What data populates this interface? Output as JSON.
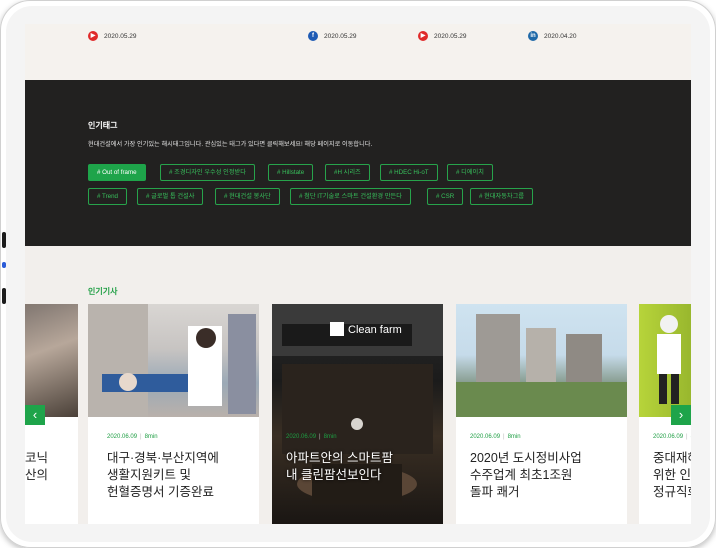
{
  "social_feed": [
    {
      "icon": "youtube-icon",
      "date": "2020.05.29"
    },
    {
      "icon": "facebook-icon",
      "date": "2020.05.29"
    },
    {
      "icon": "youtube-icon",
      "date": "2020.05.29"
    },
    {
      "icon": "linkedin-icon",
      "date": "2020.04.20"
    }
  ],
  "popular_tags": {
    "title": "인기태그",
    "description": "현대건설에서 가장 인기있는 해시태그입니다. 관심있는 태그가 있다면 클릭해보세요! 해당 페이지로 이동합니다.",
    "tags": [
      "# Out of frame",
      "# 조경디자인 우수성 인정받다",
      "# Hillstate",
      "#H 시리즈",
      "# HDEC Hi-oT",
      "# 디에이치",
      "# Trend",
      "# 글로벌 톱 건설사",
      "# 현대건설 봉사단",
      "# 첨단 IT기술로 스마트 건설환경 만든다",
      "# CSR",
      "# 현대자동차그룹"
    ],
    "active_index": 0
  },
  "popular_articles": {
    "title": "인기기사",
    "cards": [
      {
        "date": "",
        "read_time": "",
        "title": "코닉\n산의"
      },
      {
        "date": "2020.06.09",
        "read_time": "8min",
        "title": "대구·경북·부산지역에\n생활지원키트 및\n헌혈증명서 기증완료"
      },
      {
        "date": "2020.06.09",
        "read_time": "8min",
        "title": "아파트안의 스마트팜\n내 클린팜선보인다",
        "sign": "Clean farm"
      },
      {
        "date": "2020.06.09",
        "read_time": "8min",
        "title": "2020년 도시정비사업\n수주업계 최초1조원\n돌파 쾌거"
      },
      {
        "date": "2020.06.09",
        "read_time": "8",
        "title": "중대재해\n위한 인\n정규직화"
      }
    ],
    "prev_label": "‹",
    "next_label": "›"
  },
  "colors": {
    "accent": "#1ea44a",
    "dark_bg": "#222120"
  }
}
